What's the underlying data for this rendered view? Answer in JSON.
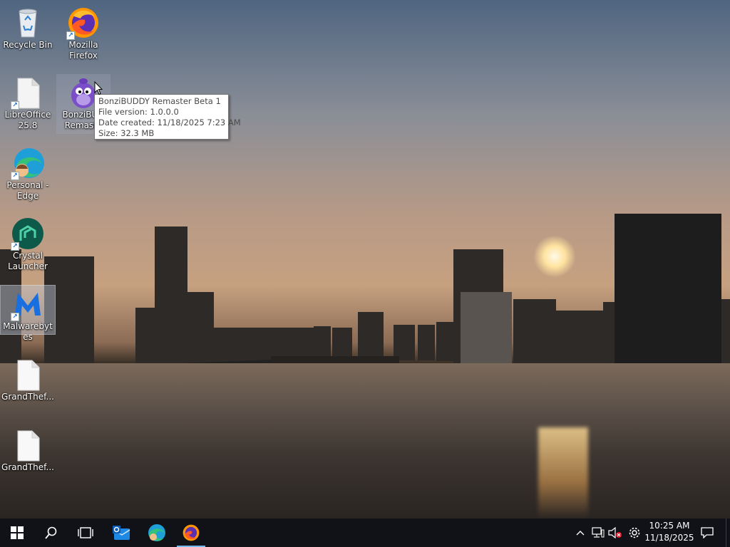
{
  "desktop": {
    "icons": [
      {
        "label": "Recycle Bin",
        "icon": "recycle-bin-icon"
      },
      {
        "label": "Mozilla Firefox",
        "icon": "firefox-icon"
      },
      {
        "label": "LibreOffice 25.8",
        "icon": "libreoffice-icon"
      },
      {
        "label": "BonziBUDDY Remaster Beta 1",
        "icon": "bonzibuddy-icon"
      },
      {
        "label": "Personal - Edge",
        "icon": "edge-profile-icon"
      },
      {
        "label": "Crystal Launcher",
        "icon": "crystal-launcher-icon"
      },
      {
        "label": "Malwarebytes",
        "icon": "malwarebytes-icon"
      },
      {
        "label": "GrandThef...",
        "icon": "file-icon"
      },
      {
        "label": "GrandThef...",
        "icon": "file-icon"
      }
    ],
    "visible_labels": {
      "recycle": "Recycle Bin",
      "firefox_l1": "Mozilla",
      "firefox_l2": "Firefox",
      "libre_l1": "LibreOffice",
      "libre_l2": "25.8",
      "bonzi_l1": "BonziBUD",
      "bonzi_l2": "Remaste",
      "edge_l1": "Personal -",
      "edge_l2": "Edge",
      "crystal_l1": "Crystal",
      "crystal_l2": "Launcher",
      "malware": "Malwarebytes",
      "gta1": "GrandThef...",
      "gta2": "GrandThef..."
    }
  },
  "tooltip": {
    "name": "BonziBUDDY Remaster Beta 1",
    "file_version": "File version: 1.0.0.0",
    "date_created": "Date created: 11/18/2025 7:23 AM",
    "size": "Size: 32.3 MB"
  },
  "taskbar": {
    "start": "start-icon",
    "search": "search-icon",
    "task_view": "task-view-icon",
    "pinned": [
      {
        "name": "mail-outlook-icon",
        "active": false
      },
      {
        "name": "edge-icon",
        "active": false
      },
      {
        "name": "firefox-icon",
        "active": true
      }
    ]
  },
  "tray": {
    "icons": [
      "chevron-up-icon",
      "network-icon",
      "volume-muted-icon",
      "settings-gear-icon"
    ],
    "time": "10:25 AM",
    "date": "11/18/2025",
    "notifications": "action-center-icon"
  },
  "colors": {
    "taskbar": "#101217",
    "active_indicator": "#76b9ed",
    "tooltip_border": "#767676"
  }
}
